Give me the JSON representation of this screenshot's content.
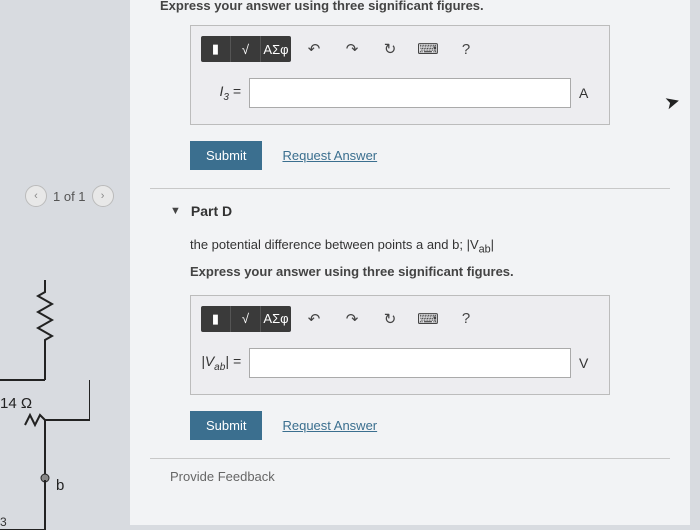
{
  "pager": {
    "prev": "‹",
    "label": "1 of 1",
    "next": "›"
  },
  "circuit": {
    "resistor": "14 Ω",
    "node_b": "b",
    "node_3": "3"
  },
  "partC": {
    "instruction_tail": "Express your answer using three significant figures.",
    "toolbar": {
      "templates": "▮",
      "sqrt": "√",
      "greek": "ΑΣφ"
    },
    "icons": {
      "undo": "↶",
      "redo": "↷",
      "reset": "↻",
      "keyboard": "⌨",
      "help": "?"
    },
    "var_html": "I<sub>3</sub> =",
    "unit": "A",
    "submit": "Submit",
    "request": "Request Answer"
  },
  "partD": {
    "header": "Part D",
    "question_html": "the potential difference between points a and b; |V<sub>ab</sub>|",
    "instruction": "Express your answer using three significant figures.",
    "toolbar": {
      "templates": "▮",
      "sqrt": "√",
      "greek": "ΑΣφ"
    },
    "icons": {
      "undo": "↶",
      "redo": "↷",
      "reset": "↻",
      "keyboard": "⌨",
      "help": "?"
    },
    "var_html": "|V<sub>ab</sub>| =",
    "unit": "V",
    "submit": "Submit",
    "request": "Request Answer"
  },
  "feedback": "Provide Feedback"
}
